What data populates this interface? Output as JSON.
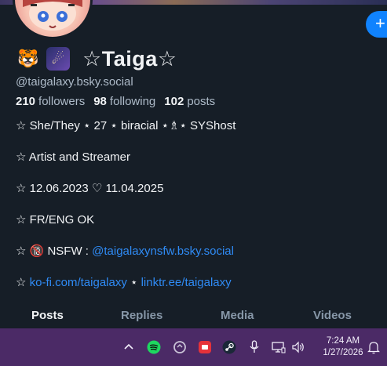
{
  "header": {
    "add_button_label": "+"
  },
  "profile": {
    "display_name": "☆Taiga☆",
    "emoji_1": "🐯",
    "emoji_2": "☄",
    "handle": "@taigalaxy.bsky.social",
    "stats": {
      "followers_count": "210",
      "followers_label": "followers",
      "following_count": "98",
      "following_label": "following",
      "posts_count": "102",
      "posts_label": "posts"
    },
    "bio": {
      "line1": "☆ She/They ⋆ 27 ⋆ biracial ⋆♗⋆ SYShost",
      "line2": "☆ Artist and Streamer",
      "line3": "☆ 12.06.2023 ♡ 11.04.2025",
      "line4": "☆ FR/ENG OK",
      "line5_prefix": "☆ 🔞 NSFW : ",
      "line5_link": "@taigalaxynsfw.bsky.social",
      "line6_prefix": "☆ ",
      "line6_link1": "ko-fi.com/taigalaxy",
      "line6_sep": " ⋆ ",
      "line6_link2": "linktr.ee/taigalaxy"
    }
  },
  "tabs": [
    {
      "label": "Posts",
      "active": true
    },
    {
      "label": "Replies",
      "active": false
    },
    {
      "label": "Media",
      "active": false
    },
    {
      "label": "Videos",
      "active": false
    }
  ],
  "taskbar": {
    "icons": [
      "chevron-up-icon",
      "spotify-icon",
      "cloud-sync-icon",
      "game-launcher-icon",
      "steam-icon",
      "microphone-icon",
      "network-icon",
      "volume-icon",
      "notification-icon"
    ],
    "time": "7:24 AM",
    "date": "1/27/2026"
  },
  "colors": {
    "background": "#161e27",
    "link": "#2f8bf5",
    "accent_button": "#1083fe",
    "taskbar": "#4b2a66",
    "muted_text": "#aebbc9"
  }
}
